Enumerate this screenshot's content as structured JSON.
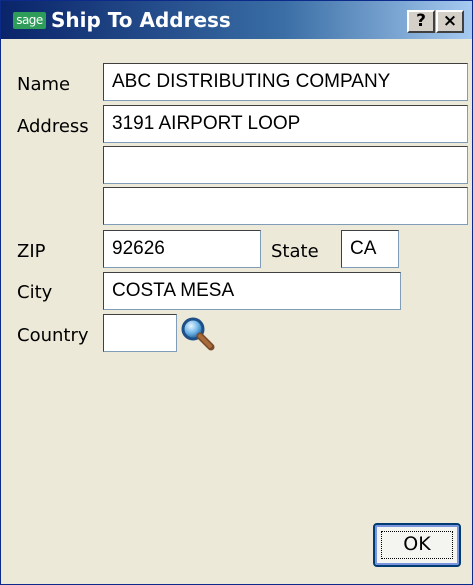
{
  "window": {
    "title": "Ship To Address",
    "logo_text": "sage",
    "help_label": "?",
    "close_label": "×"
  },
  "form": {
    "name_label": "Name",
    "name_value": "ABC DISTRIBUTING COMPANY",
    "address_label": "Address",
    "address_line1": "3191 AIRPORT LOOP",
    "address_line2": "",
    "address_line3": "",
    "zip_label": "ZIP",
    "zip_value": "92626",
    "state_label": "State",
    "state_value": "CA",
    "city_label": "City",
    "city_value": "COSTA MESA",
    "country_label": "Country",
    "country_value": ""
  },
  "buttons": {
    "ok_label": "OK"
  },
  "icons": {
    "country_lookup": "magnifier-icon"
  }
}
